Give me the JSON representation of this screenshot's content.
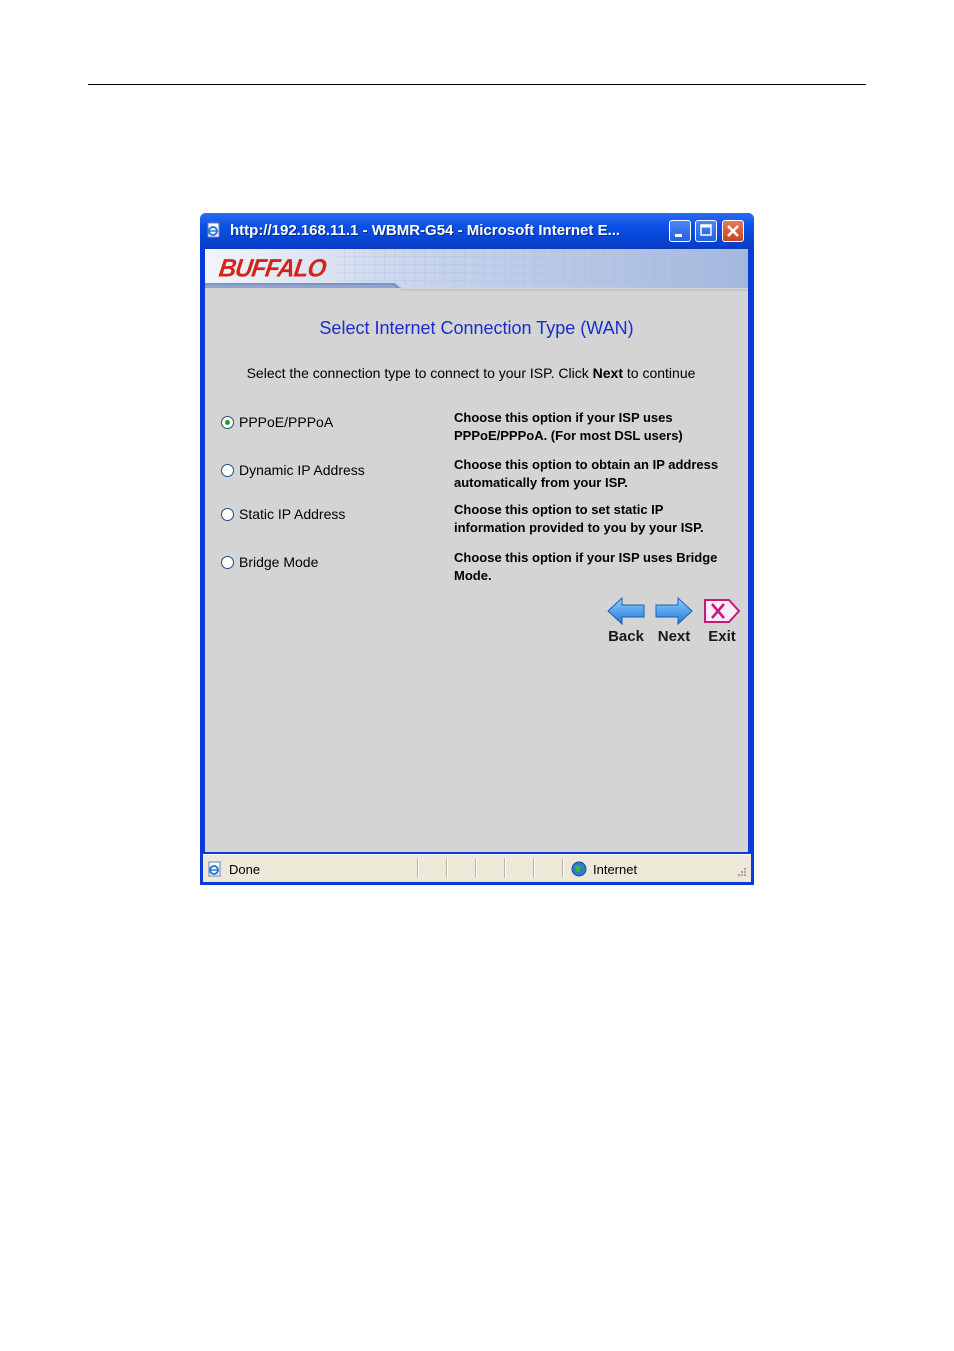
{
  "window": {
    "title": "http://192.168.11.1 - WBMR-G54 - Microsoft Internet E..."
  },
  "banner": {
    "logo": "BUFFALO"
  },
  "page": {
    "title": "Select Internet Connection Type (WAN)",
    "instruction_pre": "Select the connection type to connect to your ISP. Click ",
    "instruction_bold": "Next",
    "instruction_post": " to continue"
  },
  "options": [
    {
      "label": "PPPoE/PPPoA",
      "selected": true,
      "desc_line1": "Choose this option if your ISP uses",
      "desc_line2": "PPPoE/PPPoA. (For most DSL users)"
    },
    {
      "label": "Dynamic IP Address",
      "selected": false,
      "desc_line1": "Choose this option to obtain an IP address",
      "desc_line2": "automatically from your ISP."
    },
    {
      "label": "Static IP Address",
      "selected": false,
      "desc_line1": "Choose this option to set static IP",
      "desc_line2": "information provided to you by your ISP."
    },
    {
      "label": "Bridge Mode",
      "selected": false,
      "desc_line1": "Choose this option if your ISP uses Bridge",
      "desc_line2": "Mode."
    }
  ],
  "nav": {
    "back": "Back",
    "next": "Next",
    "exit": "Exit"
  },
  "statusbar": {
    "status": "Done",
    "zone": "Internet"
  },
  "colors": {
    "title_blue": "#1a2ccc",
    "titlebar": "#0845d6",
    "page_bg": "#d4d4d4"
  }
}
